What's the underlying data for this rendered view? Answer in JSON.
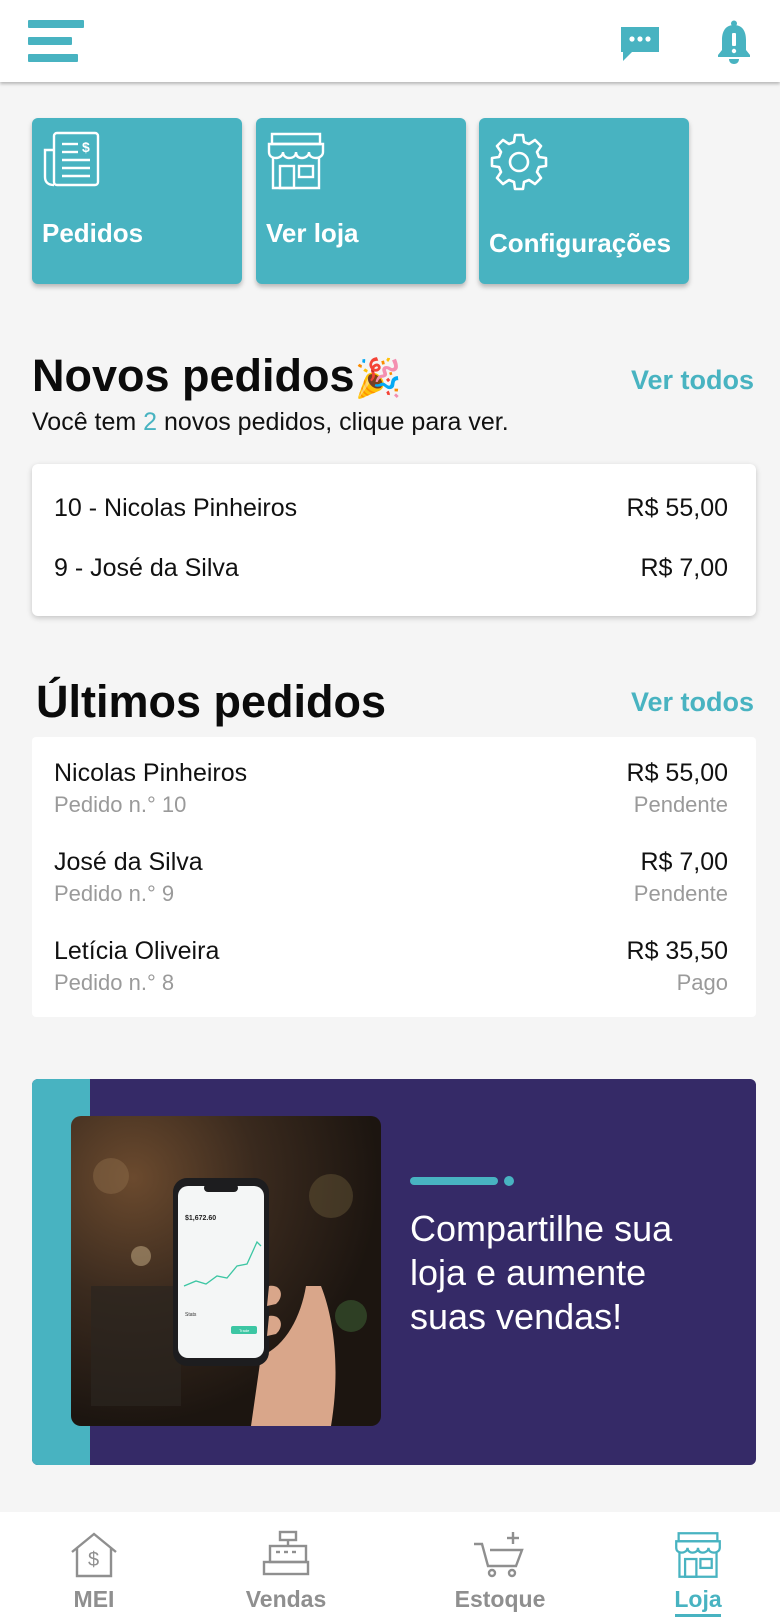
{
  "colors": {
    "accent": "#48b3c1",
    "banner": "#352a67",
    "muted": "#9a9a9a"
  },
  "header": {
    "menu_icon": "hamburger-icon",
    "chat_icon": "chat-icon",
    "bell_icon": "bell-alert-icon"
  },
  "shortcuts": [
    {
      "label": "Pedidos",
      "icon": "receipt-icon"
    },
    {
      "label": "Ver loja",
      "icon": "store-icon"
    },
    {
      "label": "Configurações",
      "icon": "gear-icon"
    }
  ],
  "new_orders": {
    "title": "Novos pedidos",
    "title_emoji": "🎉",
    "see_all": "Ver todos",
    "subtitle_pre": "Você tem ",
    "count": "2",
    "subtitle_post": " novos pedidos, clique para ver.",
    "items": [
      {
        "name": "10 - Nicolas Pinheiros",
        "amount": "R$ 55,00"
      },
      {
        "name": "9 - José da Silva",
        "amount": "R$ 7,00"
      }
    ]
  },
  "last_orders": {
    "title": "Últimos pedidos",
    "see_all": "Ver todos",
    "items": [
      {
        "name": "Nicolas Pinheiros",
        "order": "Pedido n.° 10",
        "amount": "R$ 55,00",
        "status": "Pendente"
      },
      {
        "name": "José da Silva",
        "order": "Pedido n.° 9",
        "amount": "R$ 7,00",
        "status": "Pendente"
      },
      {
        "name": "Letícia Oliveira",
        "order": "Pedido n.° 8",
        "amount": "R$ 35,50",
        "status": "Pago"
      }
    ]
  },
  "banner": {
    "text": "Compartilhe sua loja e aumente suas vendas!",
    "phone_value": "$1,672.60",
    "phone_label": "Stats",
    "phone_button": "Trade"
  },
  "bottom_nav": [
    {
      "label": "MEI",
      "icon": "house-dollar-icon",
      "active": false
    },
    {
      "label": "Vendas",
      "icon": "cash-register-icon",
      "active": false
    },
    {
      "label": "Estoque",
      "icon": "cart-plus-icon",
      "active": false
    },
    {
      "label": "Loja",
      "icon": "store-icon",
      "active": true
    }
  ]
}
